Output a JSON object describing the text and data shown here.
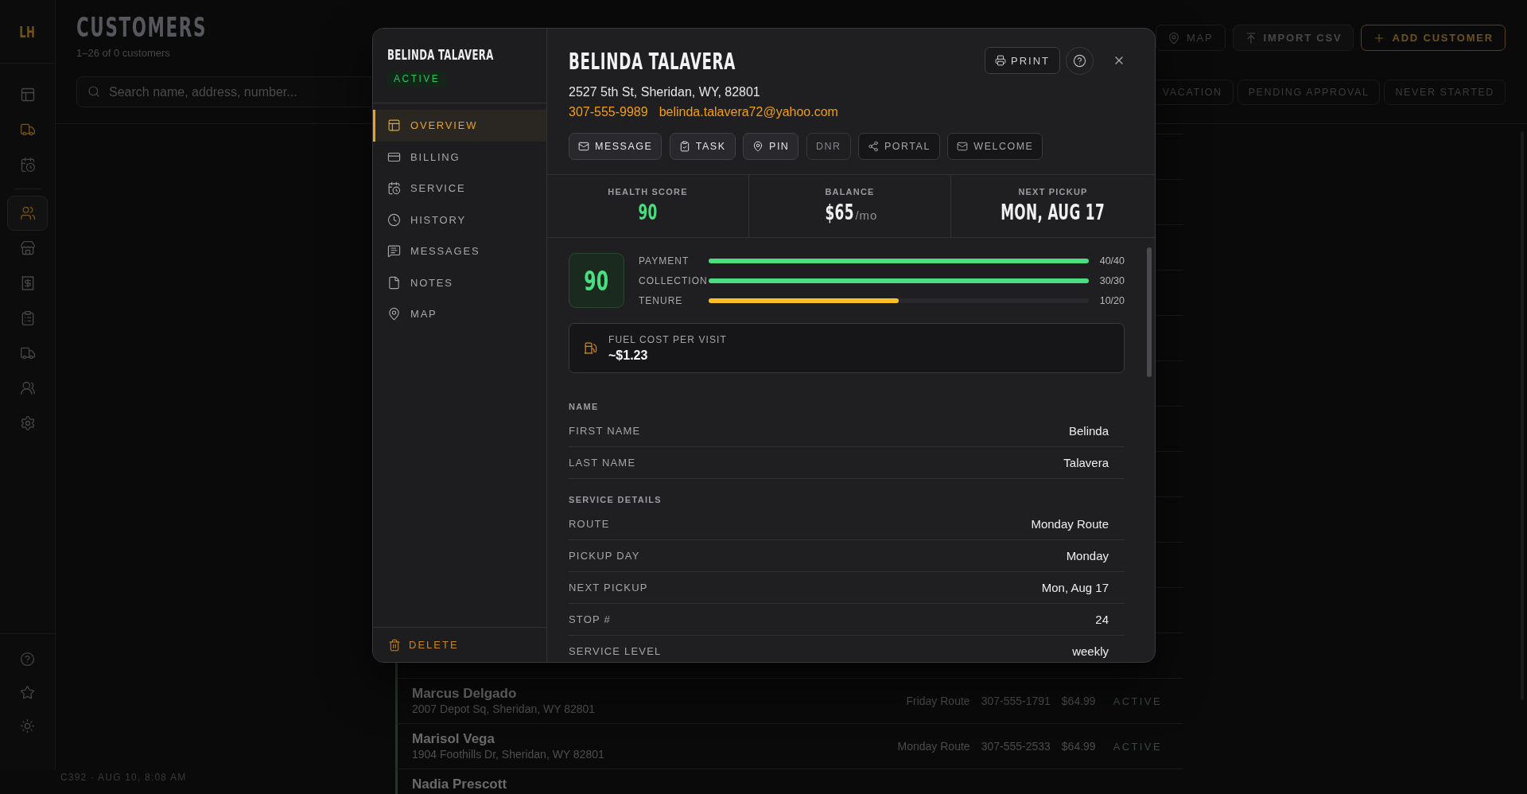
{
  "rail": {
    "brand": "LH",
    "groups": [
      {
        "items": [
          {
            "selected": false,
            "highlighted": false
          },
          {
            "selected": false,
            "highlighted": true
          },
          {
            "selected": false,
            "highlighted": false
          }
        ]
      },
      {
        "items": [
          {
            "selected": true,
            "highlighted": false
          },
          {
            "selected": false,
            "highlighted": false
          },
          {
            "selected": false,
            "highlighted": false
          },
          {
            "selected": false,
            "highlighted": false
          },
          {
            "selected": false,
            "highlighted": false
          },
          {
            "selected": false,
            "highlighted": false
          },
          {
            "selected": false,
            "highlighted": false
          }
        ]
      }
    ]
  },
  "header": {
    "title": "CUSTOMERS",
    "subtitle": "1–26 of 0 customers",
    "buttons": [
      {
        "label": "MAP",
        "kind": "ghost"
      },
      {
        "label": "IMPORT CSV",
        "kind": "secondary"
      },
      {
        "label": "ADD CUSTOMER",
        "kind": "primary"
      }
    ],
    "search": {
      "placeholder": "Search name, address, number..."
    },
    "filters": [
      {
        "label": "VACATION",
        "selected": false
      },
      {
        "label": "PENDING APPROVAL",
        "selected": false
      },
      {
        "label": "NEVER STARTED",
        "selected": false
      }
    ]
  },
  "customer_list": {
    "rows": [
      {
        "name": "Marcus Delgado",
        "address": "2007 Depot Sq, Sheridan, WY 82801",
        "route": "Friday Route",
        "phone": "307-555-1791",
        "rate": "$64.99",
        "status": "ACTIVE"
      },
      {
        "name": "Marisol Vega",
        "address": "1904 Foothills Dr, Sheridan, WY 82801",
        "route": "Monday Route",
        "phone": "307-555-2533",
        "rate": "$64.99",
        "status": "ACTIVE"
      },
      {
        "name": "Nadia Prescott"
      }
    ]
  },
  "status_bar": {
    "text": "C392 · AUG 10, 8:08 AM"
  },
  "modal": {
    "sidebar": {
      "name": "BELINDA TALAVERA",
      "status": "ACTIVE",
      "nav": [
        {
          "label": "OVERVIEW",
          "selected": true
        },
        {
          "label": "BILLING",
          "selected": false
        },
        {
          "label": "SERVICE",
          "selected": false
        },
        {
          "label": "HISTORY",
          "selected": false
        },
        {
          "label": "MESSAGES",
          "selected": false
        },
        {
          "label": "NOTES",
          "selected": false
        },
        {
          "label": "MAP",
          "selected": false
        }
      ],
      "delete": "DELETE"
    },
    "header": {
      "name": "BELINDA TALAVERA",
      "print": "PRINT",
      "address": "2527 5th St, Sheridan, WY, 82801",
      "phone": "307-555-9989",
      "email": "belinda.talavera72@yahoo.com",
      "actions": [
        {
          "label": "MESSAGE",
          "kind": "primary"
        },
        {
          "label": "TASK",
          "kind": "primary"
        },
        {
          "label": "PIN",
          "kind": "primary"
        },
        {
          "label": "DNR",
          "kind": "flag"
        },
        {
          "label": "PORTAL",
          "kind": "send"
        },
        {
          "label": "WELCOME",
          "kind": "send"
        }
      ]
    },
    "stats": [
      {
        "label": "HEALTH SCORE",
        "value": "90",
        "kind": "score"
      },
      {
        "label": "BALANCE",
        "value": "$65",
        "unit": "/mo",
        "kind": "money"
      },
      {
        "label": "NEXT PICKUP",
        "value": "MON, AUG 17",
        "kind": "date"
      }
    ],
    "health": {
      "score": "90",
      "factors": [
        {
          "label": "PAYMENT",
          "level": 1,
          "reading": "40/40",
          "color": "#4ade80"
        },
        {
          "label": "COLLECTION",
          "level": 1,
          "reading": "30/30",
          "color": "#4ade80"
        },
        {
          "label": "TENURE",
          "level": 0.5,
          "reading": "10/20",
          "color": "#fbbf24"
        }
      ]
    },
    "fuel": {
      "label": "FUEL COST PER VISIT",
      "value": "~$1.23"
    },
    "sections": [
      {
        "title": "NAME",
        "fields": [
          {
            "label": "FIRST NAME",
            "value": "Belinda"
          },
          {
            "label": "LAST NAME",
            "value": "Talavera"
          }
        ]
      },
      {
        "title": "SERVICE DETAILS",
        "fields": [
          {
            "label": "ROUTE",
            "value": "Monday Route"
          },
          {
            "label": "PICKUP DAY",
            "value": "Monday"
          },
          {
            "label": "NEXT PICKUP",
            "value": "Mon, Aug 17"
          },
          {
            "label": "STOP #",
            "value": "24"
          },
          {
            "label": "SERVICE LEVEL",
            "value": "weekly"
          }
        ]
      }
    ]
  }
}
